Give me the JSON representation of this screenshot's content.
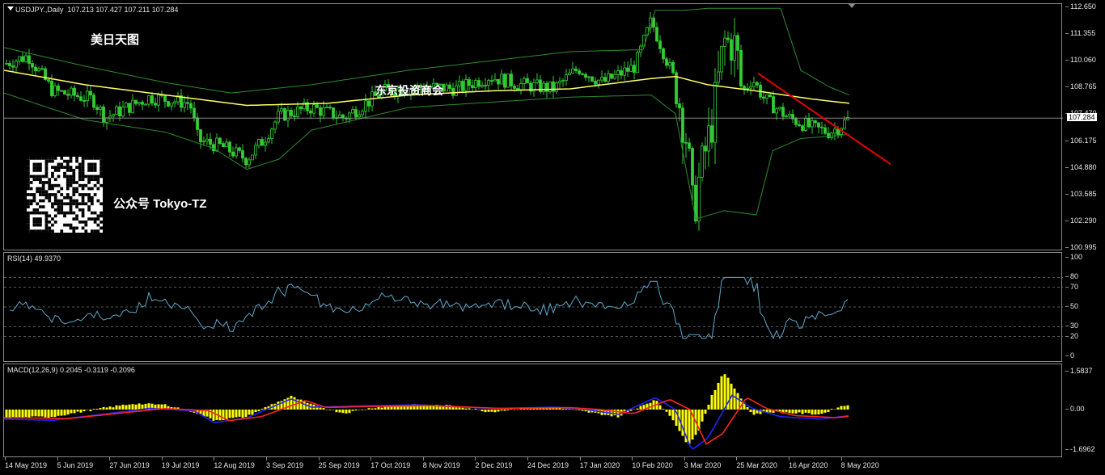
{
  "chart_header": {
    "symbol": "USDJPY.,Daily",
    "ohlc": "107.213 107.427 107.211 107.284"
  },
  "watermarks": {
    "title": "美日天图",
    "center": "东京投资商会",
    "account": "公众号 Tokyo-TZ"
  },
  "price_axis": {
    "labels": [
      "112.650",
      "111.355",
      "110.060",
      "108.765",
      "107.470",
      "106.175",
      "104.880",
      "103.585",
      "102.290",
      "100.995"
    ],
    "current": "107.284"
  },
  "rsi": {
    "label": "RSI(14) 49.9370",
    "levels": [
      "100",
      "80",
      "70",
      "50",
      "30",
      "20",
      "0"
    ]
  },
  "macd": {
    "label": "MACD(12,26,9) 0.2045 -0.3119 -0.2096",
    "levels": [
      "1.5837",
      "0.00",
      "-1.6962"
    ]
  },
  "time_axis": [
    "14 May 2019",
    "5 Jun 2019",
    "27 Jun 2019",
    "19 Jul 2019",
    "12 Aug 2019",
    "3 Sep 2019",
    "25 Sep 2019",
    "17 Oct 2019",
    "8 Nov 2019",
    "2 Dec 2019",
    "24 Dec 2019",
    "17 Jan 2020",
    "10 Feb 2020",
    "3 Mar 2020",
    "25 Mar 2020",
    "16 Apr 2020",
    "8 May 2020"
  ],
  "chart_data": {
    "type": "line",
    "title": "USDJPY.,Daily",
    "series": [
      {
        "name": "USDJPY Close",
        "x": [
          "14 May 2019",
          "5 Jun 2019",
          "27 Jun 2019",
          "19 Jul 2019",
          "12 Aug 2019",
          "3 Sep 2019",
          "25 Sep 2019",
          "17 Oct 2019",
          "8 Nov 2019",
          "2 Dec 2019",
          "24 Dec 2019",
          "17 Jan 2020",
          "10 Feb 2020",
          "3 Mar 2020",
          "25 Mar 2020",
          "16 Apr 2020",
          "8 May 2020"
        ],
        "values": [
          109.6,
          108.3,
          107.8,
          107.9,
          105.6,
          106.5,
          107.6,
          108.6,
          109.2,
          108.9,
          109.4,
          110.1,
          109.8,
          107.0,
          111.2,
          107.6,
          107.284
        ]
      }
    ],
    "ylim": [
      100.995,
      112.65
    ],
    "colors": {
      "candles": "#32cd32",
      "ma": "#ffff66",
      "bands": "#2e8b2e",
      "trendline": "#e60000",
      "rsi": "#5fa8c9",
      "macd_hist": "#ffff00",
      "macd_main": "#2222ff",
      "macd_signal": "#ff2222"
    }
  }
}
